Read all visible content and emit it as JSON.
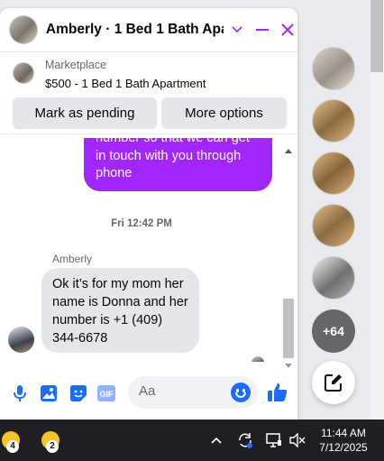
{
  "chat": {
    "title": "Amberly · 1 Bed 1 Bath Apa...",
    "marketplace_label": "Marketplace",
    "listing": "$500 - 1 Bed 1 Bath Apartment",
    "mark_pending_label": "Mark as pending",
    "more_options_label": "More options",
    "outgoing_message_partial": "number so that we can get in touch with you through phone",
    "timestamp": "Fri 12:42 PM",
    "sender_name": "Amberly",
    "incoming_message": "Ok it’s for my mom her name is Donna and her number is +1 (409) 344-6678",
    "composer_placeholder": "Aa",
    "accent_color": "#a227ff",
    "icon_color": "#1e6bff"
  },
  "rail": {
    "more_chats_label": "+64"
  },
  "taskbar": {
    "app1_badge": "4",
    "app2_badge": "2",
    "time": "11:44 AM",
    "date": "7/12/2025"
  },
  "icons": [
    "chevron-down-icon",
    "minimize-icon",
    "close-icon",
    "mic-icon",
    "image-icon",
    "sticker-icon",
    "gif-icon",
    "emoji-icon",
    "thumbs-up-icon",
    "compose-icon",
    "chevron-up-icon",
    "sync-icon",
    "display-icon",
    "volume-muted-icon"
  ]
}
